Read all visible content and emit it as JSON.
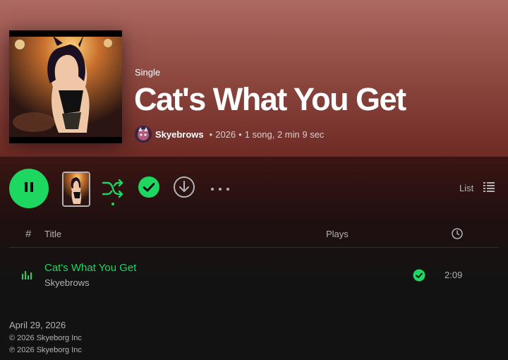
{
  "album": {
    "type_label": "Single",
    "title": "Cat's What You Get",
    "artist": "Skyebrows",
    "year": "2026",
    "separator": "•",
    "summary": "1 song, 2 min 9 sec"
  },
  "actions": {
    "view_label": "List"
  },
  "tracklist": {
    "header": {
      "number": "#",
      "title": "Title",
      "plays": "Plays"
    },
    "tracks": [
      {
        "title": "Cat's What You Get",
        "artist": "Skyebrows",
        "duration": "2:09",
        "saved": true,
        "playing": true
      }
    ]
  },
  "footer": {
    "release_date": "April 29, 2026",
    "copyright": "© 2026 Skyeborg Inc",
    "phonographic": "℗ 2026 Skyeborg Inc"
  },
  "colors": {
    "accent": "#1ed760",
    "header_top": "#ad6a62",
    "header_bottom": "#6e2a24",
    "background": "#121212",
    "muted_text": "#b3b3b3"
  },
  "icons": {
    "play_button": "pause-icon",
    "shuffle": "shuffle-icon",
    "saved": "check-circle-icon",
    "download": "download-icon",
    "more": "more-horizontal-icon",
    "view": "list-icon",
    "duration": "clock-icon",
    "now_playing": "equalizer-icon"
  }
}
